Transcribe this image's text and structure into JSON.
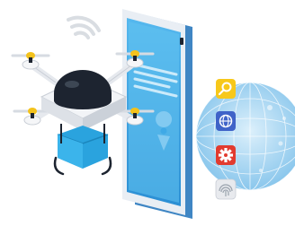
{
  "illustration": {
    "subject": "drone-with-smartphone-and-globe",
    "colors": {
      "phone_body": "#5b9fd6",
      "phone_screen": "#3fa9e6",
      "phone_screen_light": "#8fd0f3",
      "globe": "#9fd3f2",
      "drone_body": "#f2f4f7",
      "drone_dome": "#1d2430",
      "drone_bumper": "#2aa3de",
      "propeller_tip": "#f3c21b",
      "signal": "#d9dde2"
    },
    "app_icons": [
      {
        "icon": "search-icon",
        "color": "#f7c81a"
      },
      {
        "icon": "globe-icon",
        "color": "#3f63c8"
      },
      {
        "icon": "gear-icon",
        "color": "#e23b2f"
      },
      {
        "icon": "fingerprint-icon",
        "color": "#e8eaee"
      }
    ]
  }
}
